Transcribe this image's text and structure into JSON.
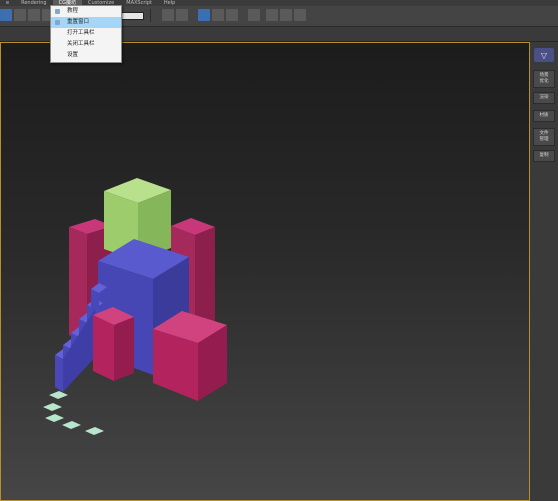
{
  "menubar": {
    "items": [
      {
        "label": "e"
      },
      {
        "label": "Rendering"
      },
      {
        "label": "CG魔坊"
      },
      {
        "label": "Customize"
      },
      {
        "label": "MAXScript"
      },
      {
        "label": "Help"
      }
    ],
    "active_index": 2
  },
  "dropdown": {
    "items": [
      {
        "label": "教程"
      },
      {
        "label": "重置窗口"
      },
      {
        "label": "打开工具栏"
      },
      {
        "label": "关闭工具栏"
      },
      {
        "label": "设置"
      }
    ],
    "highlighted_index": 1
  },
  "sidepanel": {
    "tabs": [
      {
        "label": "场景\n优化"
      },
      {
        "label": "渲染"
      },
      {
        "label": "材质"
      },
      {
        "label": "文件\n管理"
      },
      {
        "label": "复制"
      }
    ]
  },
  "colors": {
    "viewport_border": "#b78f2c",
    "box_magenta": "#b3245f",
    "box_blue": "#4b4bc0",
    "box_green": "#a4d173",
    "plate_mint": "#a9dcc0"
  }
}
